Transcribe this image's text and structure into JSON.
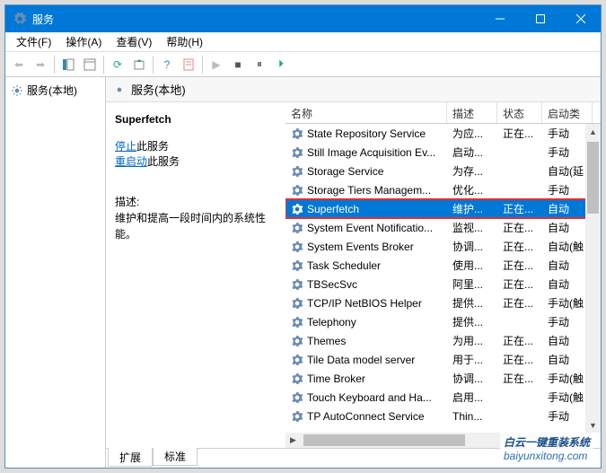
{
  "window": {
    "title": "服务"
  },
  "menubar": [
    "文件(F)",
    "操作(A)",
    "查看(V)",
    "帮助(H)"
  ],
  "leftpane": {
    "root": "服务(本地)"
  },
  "rightheader": "服务(本地)",
  "detail": {
    "name": "Superfetch",
    "stop_pre": "停止",
    "stop_post": "此服务",
    "restart_pre": "重启动",
    "restart_post": "此服务",
    "desc_label": "描述:",
    "desc_text": "维护和提高一段时间内的系统性能。"
  },
  "columns": {
    "name": "名称",
    "desc": "描述",
    "state": "状态",
    "start": "启动类"
  },
  "services": [
    {
      "name": "State Repository Service",
      "desc": "为应...",
      "state": "正在...",
      "start": "手动"
    },
    {
      "name": "Still Image Acquisition Ev...",
      "desc": "启动...",
      "state": "",
      "start": "手动"
    },
    {
      "name": "Storage Service",
      "desc": "为存...",
      "state": "",
      "start": "自动(延"
    },
    {
      "name": "Storage Tiers Managem...",
      "desc": "优化...",
      "state": "",
      "start": "手动"
    },
    {
      "name": "Superfetch",
      "desc": "维护...",
      "state": "正在...",
      "start": "自动",
      "selected": true
    },
    {
      "name": "System Event Notificatio...",
      "desc": "监视...",
      "state": "正在...",
      "start": "自动"
    },
    {
      "name": "System Events Broker",
      "desc": "协调...",
      "state": "正在...",
      "start": "自动(触"
    },
    {
      "name": "Task Scheduler",
      "desc": "使用...",
      "state": "正在...",
      "start": "自动"
    },
    {
      "name": "TBSecSvc",
      "desc": "阿里...",
      "state": "正在...",
      "start": "自动"
    },
    {
      "name": "TCP/IP NetBIOS Helper",
      "desc": "提供...",
      "state": "正在...",
      "start": "手动(触"
    },
    {
      "name": "Telephony",
      "desc": "提供...",
      "state": "",
      "start": "手动"
    },
    {
      "name": "Themes",
      "desc": "为用...",
      "state": "正在...",
      "start": "自动"
    },
    {
      "name": "Tile Data model server",
      "desc": "用于...",
      "state": "正在...",
      "start": "自动"
    },
    {
      "name": "Time Broker",
      "desc": "协调...",
      "state": "正在...",
      "start": "手动(触"
    },
    {
      "name": "Touch Keyboard and Ha...",
      "desc": "启用...",
      "state": "",
      "start": "手动(触"
    },
    {
      "name": "TP AutoConnect Service",
      "desc": "Thin...",
      "state": "",
      "start": "手动"
    }
  ],
  "tabs": {
    "extended": "扩展",
    "standard": "标准"
  },
  "watermark": {
    "line1": "白云一键重装系统",
    "line2": "baiyunxitong.com"
  }
}
